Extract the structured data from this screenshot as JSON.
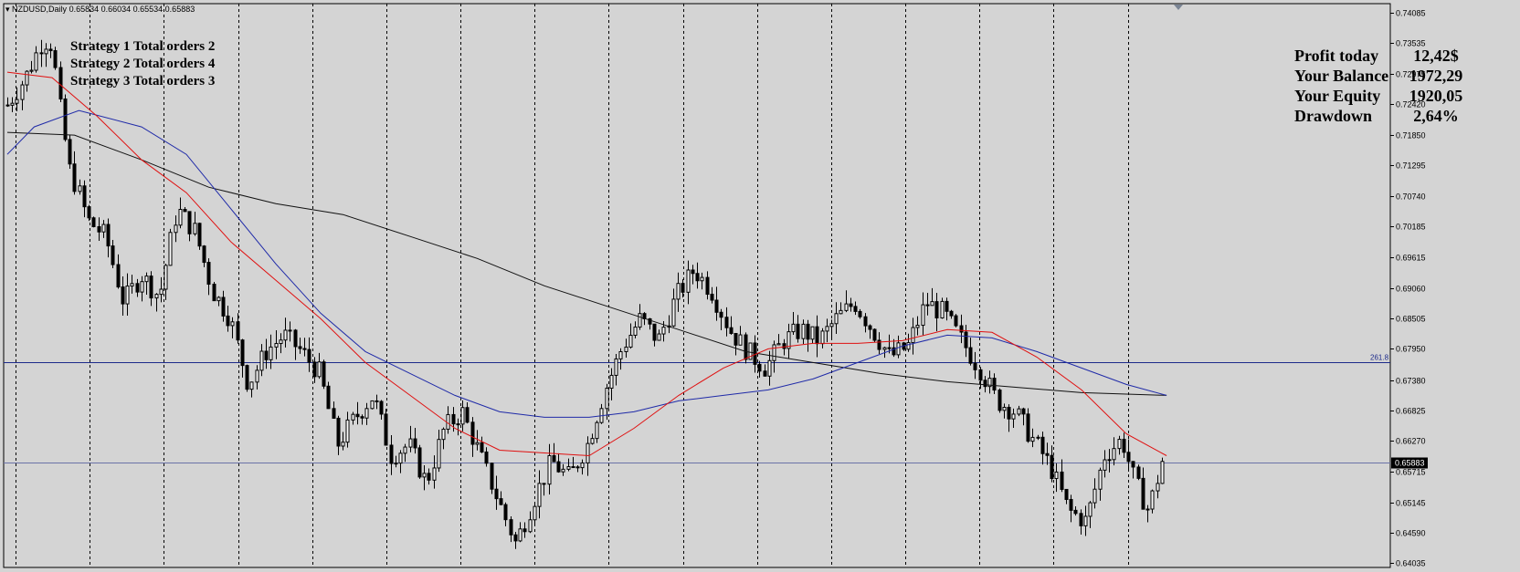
{
  "header": {
    "symbol": "NZDUSD,Daily",
    "ohlc": "0.65834 0.66034 0.65534 0.65883"
  },
  "strategies": [
    {
      "label": "Strategy 1 Total orders 2"
    },
    {
      "label": "Strategy 2 Total orders 4"
    },
    {
      "label": "Strategy 3 Total orders 3"
    }
  ],
  "account": [
    {
      "label": "Profit today",
      "value": "12,42$"
    },
    {
      "label": "Your Balance",
      "value": "1972,29"
    },
    {
      "label": "Your Equity",
      "value": "1920,05"
    },
    {
      "label": "Drawdown",
      "value": "2,64%"
    }
  ],
  "chart_data": {
    "type": "candlestick",
    "ylim": [
      0.6396,
      0.7425
    ],
    "y_ticks": [
      "0.74085",
      "0.73535",
      "0.72975",
      "0.72420",
      "0.71850",
      "0.71295",
      "0.70740",
      "0.70185",
      "0.69615",
      "0.69060",
      "0.68505",
      "0.67950",
      "0.67380",
      "0.66825",
      "0.66270",
      "0.65715",
      "0.65145",
      "0.64590",
      "0.64035"
    ],
    "current_price": 0.65883,
    "current_price_label": "0.65883",
    "fib_level": {
      "price": 0.677,
      "label": "261.8"
    },
    "candle_count": 242,
    "period_separators": 15,
    "price_path": [
      [
        0,
        0.724
      ],
      [
        4,
        0.729
      ],
      [
        8,
        0.736
      ],
      [
        10,
        0.735
      ],
      [
        12,
        0.722
      ],
      [
        14,
        0.712
      ],
      [
        16,
        0.708
      ],
      [
        18,
        0.703
      ],
      [
        22,
        0.7
      ],
      [
        26,
        0.688
      ],
      [
        30,
        0.693
      ],
      [
        34,
        0.689
      ],
      [
        38,
        0.705
      ],
      [
        42,
        0.701
      ],
      [
        46,
        0.69
      ],
      [
        50,
        0.685
      ],
      [
        54,
        0.673
      ],
      [
        58,
        0.679
      ],
      [
        62,
        0.682
      ],
      [
        66,
        0.679
      ],
      [
        70,
        0.675
      ],
      [
        74,
        0.662
      ],
      [
        78,
        0.667
      ],
      [
        82,
        0.671
      ],
      [
        86,
        0.66
      ],
      [
        90,
        0.662
      ],
      [
        94,
        0.655
      ],
      [
        98,
        0.665
      ],
      [
        102,
        0.668
      ],
      [
        106,
        0.66
      ],
      [
        110,
        0.652
      ],
      [
        114,
        0.644
      ],
      [
        118,
        0.652
      ],
      [
        122,
        0.659
      ],
      [
        126,
        0.656
      ],
      [
        130,
        0.662
      ],
      [
        134,
        0.672
      ],
      [
        138,
        0.68
      ],
      [
        142,
        0.685
      ],
      [
        146,
        0.681
      ],
      [
        150,
        0.689
      ],
      [
        154,
        0.694
      ],
      [
        158,
        0.69
      ],
      [
        162,
        0.683
      ],
      [
        166,
        0.679
      ],
      [
        170,
        0.676
      ],
      [
        174,
        0.681
      ],
      [
        178,
        0.683
      ],
      [
        182,
        0.681
      ],
      [
        186,
        0.685
      ],
      [
        190,
        0.688
      ],
      [
        194,
        0.683
      ],
      [
        198,
        0.678
      ],
      [
        202,
        0.68
      ],
      [
        206,
        0.688
      ],
      [
        210,
        0.686
      ],
      [
        214,
        0.681
      ],
      [
        218,
        0.676
      ],
      [
        222,
        0.67
      ],
      [
        226,
        0.668
      ],
      [
        230,
        0.663
      ],
      [
        234,
        0.658
      ],
      [
        238,
        0.65
      ],
      [
        242,
        0.648
      ],
      [
        246,
        0.66
      ],
      [
        250,
        0.663
      ],
      [
        253,
        0.655
      ],
      [
        256,
        0.65
      ],
      [
        259,
        0.659
      ]
    ],
    "ma_red": [
      [
        0,
        0.73
      ],
      [
        10,
        0.729
      ],
      [
        20,
        0.722
      ],
      [
        30,
        0.714
      ],
      [
        40,
        0.708
      ],
      [
        50,
        0.699
      ],
      [
        60,
        0.692
      ],
      [
        70,
        0.685
      ],
      [
        80,
        0.677
      ],
      [
        90,
        0.671
      ],
      [
        100,
        0.665
      ],
      [
        110,
        0.661
      ],
      [
        120,
        0.6605
      ],
      [
        130,
        0.66
      ],
      [
        140,
        0.665
      ],
      [
        150,
        0.671
      ],
      [
        160,
        0.676
      ],
      [
        170,
        0.6795
      ],
      [
        180,
        0.6805
      ],
      [
        190,
        0.6805
      ],
      [
        200,
        0.681
      ],
      [
        210,
        0.683
      ],
      [
        220,
        0.6825
      ],
      [
        230,
        0.678
      ],
      [
        240,
        0.672
      ],
      [
        250,
        0.664
      ],
      [
        259,
        0.66
      ]
    ],
    "ma_blue": [
      [
        0,
        0.715
      ],
      [
        6,
        0.72
      ],
      [
        16,
        0.723
      ],
      [
        30,
        0.72
      ],
      [
        40,
        0.715
      ],
      [
        50,
        0.705
      ],
      [
        60,
        0.695
      ],
      [
        70,
        0.686
      ],
      [
        80,
        0.679
      ],
      [
        90,
        0.675
      ],
      [
        100,
        0.671
      ],
      [
        110,
        0.668
      ],
      [
        120,
        0.667
      ],
      [
        130,
        0.667
      ],
      [
        140,
        0.668
      ],
      [
        150,
        0.67
      ],
      [
        160,
        0.671
      ],
      [
        170,
        0.672
      ],
      [
        180,
        0.674
      ],
      [
        190,
        0.677
      ],
      [
        200,
        0.68
      ],
      [
        210,
        0.682
      ],
      [
        220,
        0.6815
      ],
      [
        230,
        0.679
      ],
      [
        240,
        0.676
      ],
      [
        250,
        0.673
      ],
      [
        259,
        0.671
      ]
    ],
    "ma_black": [
      [
        0,
        0.719
      ],
      [
        15,
        0.7185
      ],
      [
        30,
        0.714
      ],
      [
        45,
        0.709
      ],
      [
        60,
        0.706
      ],
      [
        75,
        0.704
      ],
      [
        90,
        0.7
      ],
      [
        105,
        0.696
      ],
      [
        120,
        0.691
      ],
      [
        135,
        0.687
      ],
      [
        150,
        0.683
      ],
      [
        165,
        0.679
      ],
      [
        180,
        0.677
      ],
      [
        195,
        0.675
      ],
      [
        210,
        0.6735
      ],
      [
        225,
        0.6725
      ],
      [
        240,
        0.6715
      ],
      [
        259,
        0.671
      ]
    ]
  }
}
